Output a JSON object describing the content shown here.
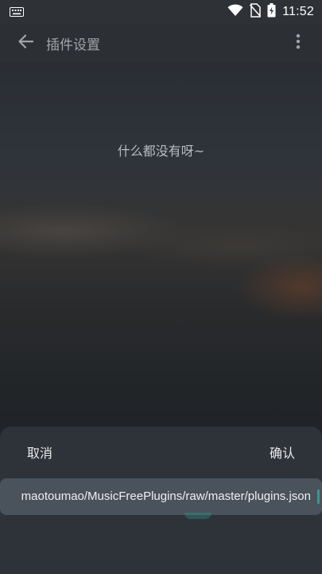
{
  "status_bar": {
    "time": "11:52",
    "icons": [
      "keyboard-icon",
      "wifi-icon",
      "no-sim-icon",
      "battery-charging-icon"
    ]
  },
  "app_bar": {
    "title": "插件设置",
    "back_icon": "arrow-left-icon",
    "menu_icon": "more-vertical-icon"
  },
  "main": {
    "empty_text": "什么都没有呀~"
  },
  "sheet": {
    "cancel_label": "取消",
    "confirm_label": "确认",
    "url_value": "maotoumao/MusicFreePlugins/raw/master/plugins.json"
  },
  "colors": {
    "app_bar": "#2c3035",
    "sheet": "#2e3339",
    "field": "#4a525b",
    "accent": "#2f9e8f"
  }
}
